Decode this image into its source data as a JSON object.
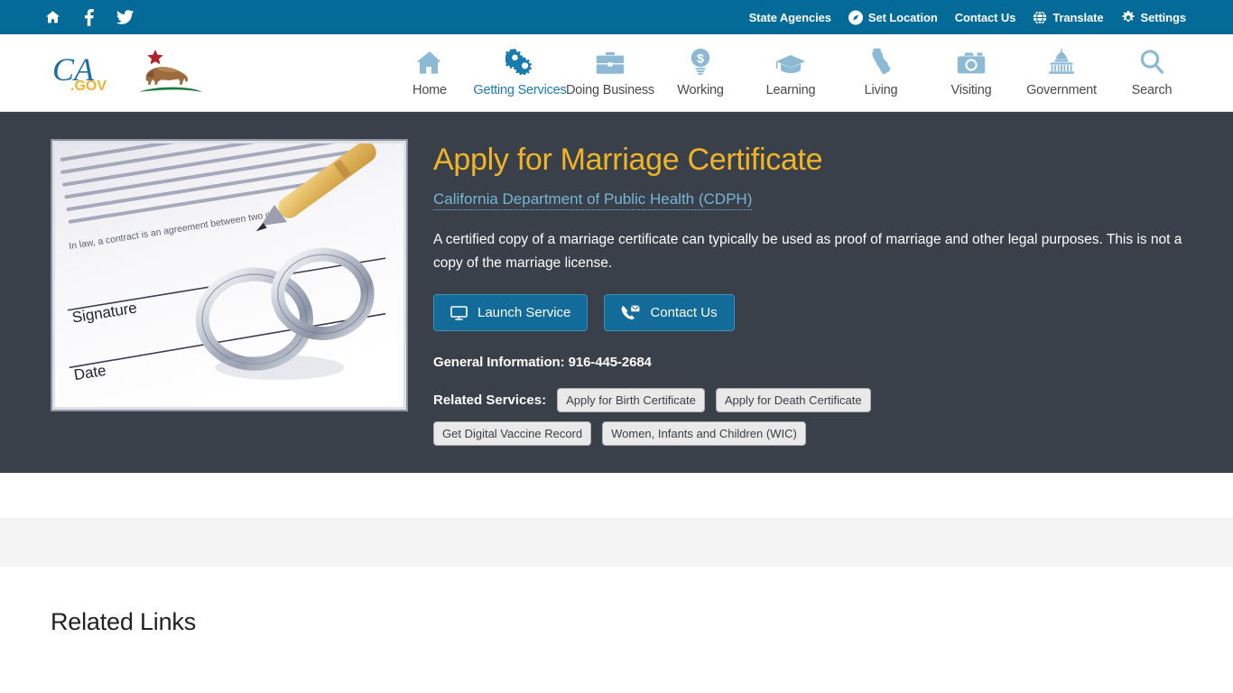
{
  "utility_bar": {
    "social": [
      {
        "name": "home-icon",
        "label": "Home"
      },
      {
        "name": "facebook-icon",
        "label": "Facebook"
      },
      {
        "name": "twitter-icon",
        "label": "Twitter"
      }
    ],
    "links": [
      {
        "label": "State Agencies",
        "icon": ""
      },
      {
        "label": "Set Location",
        "icon": "location-icon"
      },
      {
        "label": "Contact Us",
        "icon": ""
      },
      {
        "label": "Translate",
        "icon": "globe-icon"
      },
      {
        "label": "Settings",
        "icon": "gear-icon"
      }
    ]
  },
  "brand": {
    "text": "CA",
    "suffix": ".GOV",
    "alt": "CA.gov California state seal with grizzly bear and red star"
  },
  "nav": {
    "items": [
      {
        "label": "Home",
        "icon": "house-icon",
        "active": false
      },
      {
        "label": "Getting Services",
        "icon": "gears-icon",
        "active": true
      },
      {
        "label": "Doing Business",
        "icon": "briefcase-icon",
        "active": false
      },
      {
        "label": "Working",
        "icon": "dollar-bulb-icon",
        "active": false
      },
      {
        "label": "Learning",
        "icon": "graduation-cap-icon",
        "active": false
      },
      {
        "label": "Living",
        "icon": "california-state-icon",
        "active": false
      },
      {
        "label": "Visiting",
        "icon": "camera-icon",
        "active": false
      },
      {
        "label": "Government",
        "icon": "capitol-icon",
        "active": false
      },
      {
        "label": "Search",
        "icon": "search-icon",
        "active": false
      }
    ]
  },
  "hero": {
    "image_alt": "Two wedding rings resting on a marriage contract with Signature and Date lines and a gold pen",
    "image_text": {
      "signature": "Signature",
      "date": "Date",
      "body_line": "In law, a contract is an agreement between two or"
    },
    "title": "Apply for Marriage Certificate",
    "agency": "California Department of Public Health (CDPH)",
    "description": "A certified copy of a marriage certificate can typically be used as proof of marriage and other legal purposes. This is not a copy of the marriage license.",
    "buttons": [
      {
        "label": "Launch Service",
        "icon": "monitor-icon"
      },
      {
        "label": "Contact Us",
        "icon": "phone-envelope-icon"
      }
    ],
    "phone_info": "General Information: 916-445-2684",
    "related_services_label": "Related Services:",
    "related_services": [
      "Apply for Birth Certificate",
      "Apply for Death Certificate",
      "Get Digital Vaccine Record",
      "Women, Infants and Children (WIC)"
    ]
  },
  "related_links": {
    "title": "Related Links"
  },
  "colors": {
    "utility_bar_bg": "#046b99",
    "hero_bg": "#3a4049",
    "title_gold": "#f0b429",
    "link_blue": "#76b5d6",
    "button_blue": "#136b99",
    "nav_active": "#1a7baf",
    "nav_icon": "#8cbad4",
    "band_gray": "#f4f4f4"
  }
}
